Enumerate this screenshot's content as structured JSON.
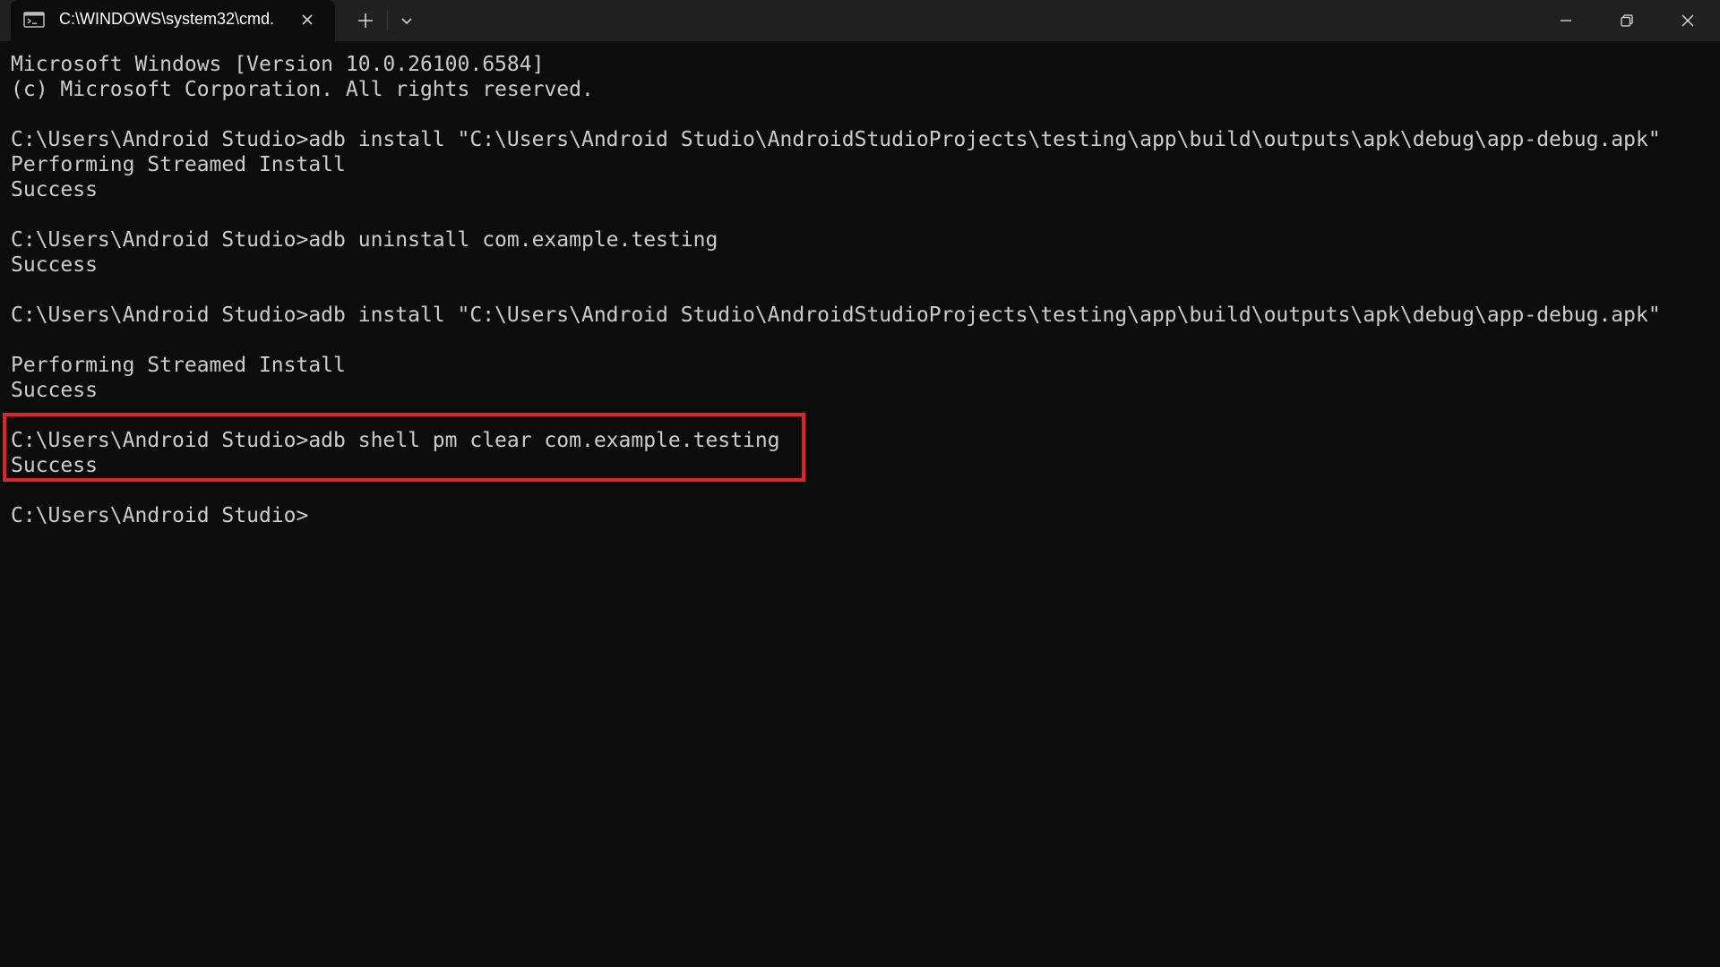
{
  "window": {
    "tab_title": "C:\\WINDOWS\\system32\\cmd.",
    "tab_icon": "cmd-terminal-icon",
    "tab_close_icon": "close-icon",
    "new_tab_icon": "plus-icon",
    "dropdown_icon": "chevron-down-icon",
    "minimize_icon": "minimize-icon",
    "maximize_icon": "restore-icon",
    "close_icon": "close-icon"
  },
  "terminal": {
    "lines": [
      "Microsoft Windows [Version 10.0.26100.6584]",
      "(c) Microsoft Corporation. All rights reserved.",
      "",
      "C:\\Users\\Android Studio>adb install \"C:\\Users\\Android Studio\\AndroidStudioProjects\\testing\\app\\build\\outputs\\apk\\debug\\app-debug.apk\"",
      "Performing Streamed Install",
      "Success",
      "",
      "C:\\Users\\Android Studio>adb uninstall com.example.testing",
      "Success",
      "",
      "C:\\Users\\Android Studio>adb install \"C:\\Users\\Android Studio\\AndroidStudioProjects\\testing\\app\\build\\outputs\\apk\\debug\\app-debug.apk\"",
      "",
      "Performing Streamed Install",
      "Success",
      "",
      "C:\\Users\\Android Studio>adb shell pm clear com.example.testing",
      "Success",
      "",
      "C:\\Users\\Android Studio>"
    ]
  },
  "colors": {
    "background": "#0c0c0c",
    "titlebar": "#202020",
    "text": "#cccccc",
    "highlight_border": "#e02424"
  }
}
